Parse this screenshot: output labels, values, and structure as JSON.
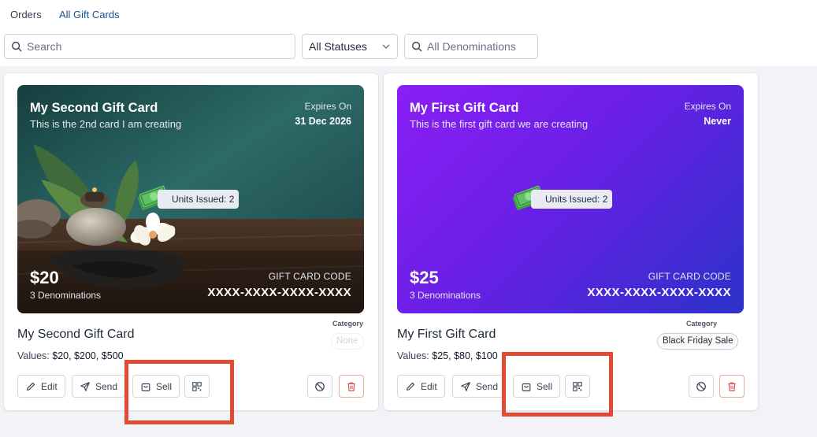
{
  "tabs": [
    {
      "label": "Orders",
      "active": false
    },
    {
      "label": "All Gift Cards",
      "active": true
    }
  ],
  "filters": {
    "search_placeholder": "Search",
    "status_value": "All Statuses",
    "denomination_placeholder": "All Denominations"
  },
  "cards": [
    {
      "title": "My Second Gift Card",
      "subtitle": "This is the 2nd card I am creating",
      "expires_label": "Expires On",
      "expires_value": "31 Dec 2026",
      "units_issued": "Units Issued: 2",
      "amount": "$20",
      "denominations": "3 Denominations",
      "code_label": "GIFT CARD CODE",
      "code_value": "XXXX-XXXX-XXXX-XXXX",
      "name": "My Second Gift Card",
      "values_label": "Values:",
      "values": "$20, $200, $500",
      "category_label": "Category",
      "category_value": "None",
      "background": "spa-photo",
      "buttons": {
        "edit": "Edit",
        "send": "Send",
        "sell": "Sell"
      }
    },
    {
      "title": "My First Gift Card",
      "subtitle": "This is the first gift card we are creating",
      "expires_label": "Expires On",
      "expires_value": "Never",
      "units_issued": "Units Issued: 2",
      "amount": "$25",
      "denominations": "3 Denominations",
      "code_label": "GIFT CARD CODE",
      "code_value": "XXXX-XXXX-XXXX-XXXX",
      "name": "My First Gift Card",
      "values_label": "Values:",
      "values": "$25, $80, $100",
      "category_label": "Category",
      "category_value": "Black Friday Sale",
      "background": "purple-gradient",
      "buttons": {
        "edit": "Edit",
        "send": "Send",
        "sell": "Sell"
      }
    }
  ],
  "colors": {
    "accent": "#1d4f91",
    "highlight": "#e24a33",
    "purple_start": "#8a1ff5",
    "purple_end": "#2b32c9",
    "delete": "#d9534f"
  },
  "icons": [
    "search-icon",
    "chevron-down-icon",
    "money-icon",
    "pencil-icon",
    "send-icon",
    "shopping-bag-icon",
    "qr-code-icon",
    "ban-icon",
    "trash-icon"
  ]
}
